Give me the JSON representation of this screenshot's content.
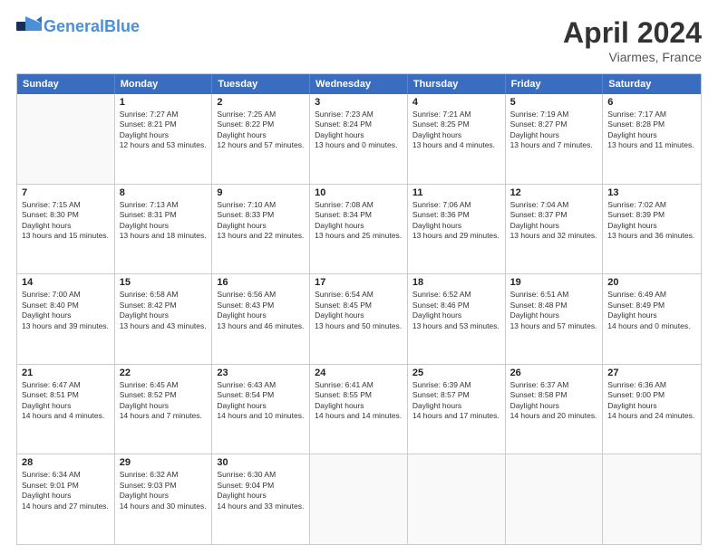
{
  "header": {
    "logo_general": "General",
    "logo_blue": "Blue",
    "month_title": "April 2024",
    "location": "Viarmes, France"
  },
  "weekdays": [
    "Sunday",
    "Monday",
    "Tuesday",
    "Wednesday",
    "Thursday",
    "Friday",
    "Saturday"
  ],
  "weeks": [
    [
      {
        "day": null
      },
      {
        "day": 1,
        "sunrise": "7:27 AM",
        "sunset": "8:21 PM",
        "daylight": "12 hours and 53 minutes."
      },
      {
        "day": 2,
        "sunrise": "7:25 AM",
        "sunset": "8:22 PM",
        "daylight": "12 hours and 57 minutes."
      },
      {
        "day": 3,
        "sunrise": "7:23 AM",
        "sunset": "8:24 PM",
        "daylight": "13 hours and 0 minutes."
      },
      {
        "day": 4,
        "sunrise": "7:21 AM",
        "sunset": "8:25 PM",
        "daylight": "13 hours and 4 minutes."
      },
      {
        "day": 5,
        "sunrise": "7:19 AM",
        "sunset": "8:27 PM",
        "daylight": "13 hours and 7 minutes."
      },
      {
        "day": 6,
        "sunrise": "7:17 AM",
        "sunset": "8:28 PM",
        "daylight": "13 hours and 11 minutes."
      }
    ],
    [
      {
        "day": 7,
        "sunrise": "7:15 AM",
        "sunset": "8:30 PM",
        "daylight": "13 hours and 15 minutes."
      },
      {
        "day": 8,
        "sunrise": "7:13 AM",
        "sunset": "8:31 PM",
        "daylight": "13 hours and 18 minutes."
      },
      {
        "day": 9,
        "sunrise": "7:10 AM",
        "sunset": "8:33 PM",
        "daylight": "13 hours and 22 minutes."
      },
      {
        "day": 10,
        "sunrise": "7:08 AM",
        "sunset": "8:34 PM",
        "daylight": "13 hours and 25 minutes."
      },
      {
        "day": 11,
        "sunrise": "7:06 AM",
        "sunset": "8:36 PM",
        "daylight": "13 hours and 29 minutes."
      },
      {
        "day": 12,
        "sunrise": "7:04 AM",
        "sunset": "8:37 PM",
        "daylight": "13 hours and 32 minutes."
      },
      {
        "day": 13,
        "sunrise": "7:02 AM",
        "sunset": "8:39 PM",
        "daylight": "13 hours and 36 minutes."
      }
    ],
    [
      {
        "day": 14,
        "sunrise": "7:00 AM",
        "sunset": "8:40 PM",
        "daylight": "13 hours and 39 minutes."
      },
      {
        "day": 15,
        "sunrise": "6:58 AM",
        "sunset": "8:42 PM",
        "daylight": "13 hours and 43 minutes."
      },
      {
        "day": 16,
        "sunrise": "6:56 AM",
        "sunset": "8:43 PM",
        "daylight": "13 hours and 46 minutes."
      },
      {
        "day": 17,
        "sunrise": "6:54 AM",
        "sunset": "8:45 PM",
        "daylight": "13 hours and 50 minutes."
      },
      {
        "day": 18,
        "sunrise": "6:52 AM",
        "sunset": "8:46 PM",
        "daylight": "13 hours and 53 minutes."
      },
      {
        "day": 19,
        "sunrise": "6:51 AM",
        "sunset": "8:48 PM",
        "daylight": "13 hours and 57 minutes."
      },
      {
        "day": 20,
        "sunrise": "6:49 AM",
        "sunset": "8:49 PM",
        "daylight": "14 hours and 0 minutes."
      }
    ],
    [
      {
        "day": 21,
        "sunrise": "6:47 AM",
        "sunset": "8:51 PM",
        "daylight": "14 hours and 4 minutes."
      },
      {
        "day": 22,
        "sunrise": "6:45 AM",
        "sunset": "8:52 PM",
        "daylight": "14 hours and 7 minutes."
      },
      {
        "day": 23,
        "sunrise": "6:43 AM",
        "sunset": "8:54 PM",
        "daylight": "14 hours and 10 minutes."
      },
      {
        "day": 24,
        "sunrise": "6:41 AM",
        "sunset": "8:55 PM",
        "daylight": "14 hours and 14 minutes."
      },
      {
        "day": 25,
        "sunrise": "6:39 AM",
        "sunset": "8:57 PM",
        "daylight": "14 hours and 17 minutes."
      },
      {
        "day": 26,
        "sunrise": "6:37 AM",
        "sunset": "8:58 PM",
        "daylight": "14 hours and 20 minutes."
      },
      {
        "day": 27,
        "sunrise": "6:36 AM",
        "sunset": "9:00 PM",
        "daylight": "14 hours and 24 minutes."
      }
    ],
    [
      {
        "day": 28,
        "sunrise": "6:34 AM",
        "sunset": "9:01 PM",
        "daylight": "14 hours and 27 minutes."
      },
      {
        "day": 29,
        "sunrise": "6:32 AM",
        "sunset": "9:03 PM",
        "daylight": "14 hours and 30 minutes."
      },
      {
        "day": 30,
        "sunrise": "6:30 AM",
        "sunset": "9:04 PM",
        "daylight": "14 hours and 33 minutes."
      },
      {
        "day": null
      },
      {
        "day": null
      },
      {
        "day": null
      },
      {
        "day": null
      }
    ]
  ]
}
